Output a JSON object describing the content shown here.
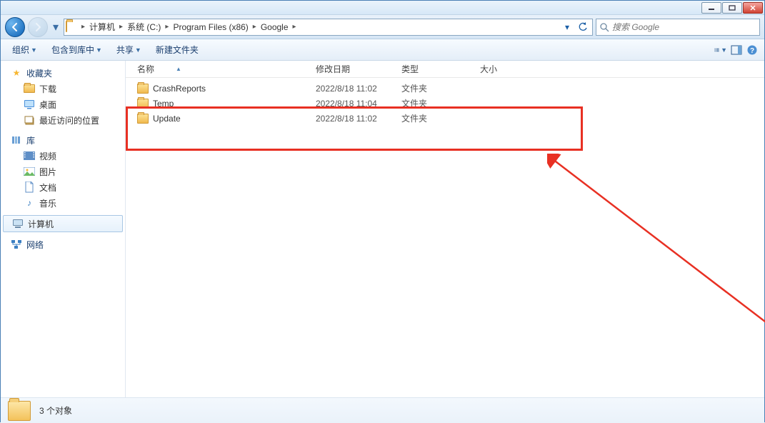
{
  "search": {
    "placeholder": "搜索 Google"
  },
  "breadcrumb": {
    "segments": [
      "计算机",
      "系统 (C:)",
      "Program Files (x86)",
      "Google"
    ]
  },
  "commands": {
    "organize": "组织",
    "include": "包含到库中",
    "share": "共享",
    "newfolder": "新建文件夹"
  },
  "sidebar": {
    "favorites": "收藏夹",
    "downloads": "下载",
    "desktop": "桌面",
    "recent": "最近访问的位置",
    "libraries": "库",
    "videos": "视频",
    "pictures": "图片",
    "documents": "文档",
    "music": "音乐",
    "computer": "计算机",
    "network": "网络"
  },
  "columns": {
    "name": "名称",
    "modified": "修改日期",
    "type": "类型",
    "size": "大小"
  },
  "rows": [
    {
      "name": "CrashReports",
      "modified": "2022/8/18 11:02",
      "type": "文件夹"
    },
    {
      "name": "Temp",
      "modified": "2022/8/18 11:04",
      "type": "文件夹"
    },
    {
      "name": "Update",
      "modified": "2022/8/18 11:02",
      "type": "文件夹"
    }
  ],
  "status": {
    "count": "3 个对象"
  }
}
